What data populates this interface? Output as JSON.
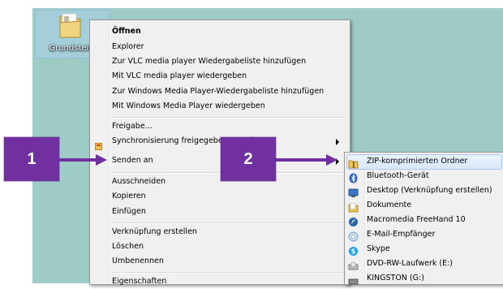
{
  "desktop": {
    "folder_label": "Grundstein"
  },
  "context_menu": {
    "items": [
      {
        "label": "Öffnen",
        "bold": true
      },
      {
        "label": "Explorer"
      },
      {
        "label": "Zur VLC media player Wiedergabeliste hinzufügen"
      },
      {
        "label": "Mit VLC media player wiedergeben"
      },
      {
        "label": "Zur Windows Media Player-Wiedergabeliste hinzufügen"
      },
      {
        "label": "Mit Windows Media Player wiedergeben"
      },
      {
        "label": "Freigabe..."
      },
      {
        "label": "Synchronisierung freigegebener Ordner"
      },
      {
        "label": "Senden an"
      },
      {
        "label": "Ausschneiden"
      },
      {
        "label": "Kopieren"
      },
      {
        "label": "Einfügen"
      },
      {
        "label": "Verknüpfung erstellen"
      },
      {
        "label": "Löschen"
      },
      {
        "label": "Umbenennen"
      },
      {
        "label": "Eigenschaften"
      }
    ]
  },
  "send_to_menu": {
    "items": [
      {
        "label": "ZIP-komprimierten Ordner",
        "icon": "zip-folder-icon"
      },
      {
        "label": "Bluetooth-Gerät",
        "icon": "bluetooth-icon"
      },
      {
        "label": "Desktop (Verknüpfung erstellen)",
        "icon": "desktop-icon"
      },
      {
        "label": "Dokumente",
        "icon": "documents-icon"
      },
      {
        "label": "Macromedia FreeHand 10",
        "icon": "freehand-icon"
      },
      {
        "label": "E-Mail-Empfänger",
        "icon": "mail-icon"
      },
      {
        "label": "Skype",
        "icon": "skype-icon"
      },
      {
        "label": "DVD-RW-Laufwerk (E:)",
        "icon": "dvd-drive-icon"
      },
      {
        "label": "KINGSTON (G:)",
        "icon": "usb-drive-icon"
      }
    ]
  },
  "callouts": {
    "step1": "1",
    "step2": "2",
    "color": "#7030a0"
  }
}
